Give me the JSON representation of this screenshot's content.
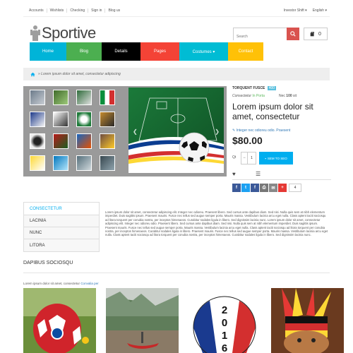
{
  "topbar": {
    "links": [
      "Accounts",
      "Wishlists",
      "Checking",
      "Sign in",
      "Blog us"
    ],
    "language": "Investor Shift ▾",
    "currency": "English ▾"
  },
  "brand": {
    "name": "Sportive"
  },
  "search": {
    "placeholder": "Search"
  },
  "cart": {
    "count": "0"
  },
  "nav": [
    {
      "label": "Home",
      "color": "#00b4d8",
      "width": 52
    },
    {
      "label": "Blog",
      "color": "#4caf50",
      "width": 50
    },
    {
      "label": "Details",
      "color": "#000000",
      "width": 55
    },
    {
      "label": "Pages",
      "color": "#f44336",
      "width": 55
    },
    {
      "label": "Costumes ▾",
      "color": "#00bcd4",
      "width": 69
    },
    {
      "label": "Contact",
      "color": "#ffc107",
      "width": 50
    }
  ],
  "breadcrumb": {
    "text": "» Lorem ipsum dolor sit amet, consectetur adipiscing"
  },
  "product": {
    "brand_label": "TORQUENT FUSCE",
    "brand_count": "400",
    "condition_label": "Consectetur",
    "condition_value": "In Porta",
    "stock_label": "Nec",
    "stock_value": "100",
    "stock_unit": "sit",
    "title": "Lorem ipsum dolor sit amet, consectetur",
    "link": "Integer nec odioreu odio. Praesent",
    "price": "$80.00",
    "qty_label": "Qt",
    "qty_value": "1",
    "add_to_cart": "SEM TO SEO",
    "social_count": "4"
  },
  "tabs": [
    "CONSECTETUR",
    "LACINIA",
    "NUNC",
    "LITORA"
  ],
  "description": "Lorem ipsum dolor sit amet, consectetur adipiscing elit. Integer nec odioreu. Praesent libero. Sed cursus ante dapibus diam. Sed nisi. Nulla quis sem at nibh elementum imperdiet. Duis sagittis ipsum. Praesent mauris. Fusce nec tellus sed augue semper porta. Mauris massa. Vestibulum lacinia arcu eget nulla. Class aptent taciti sociosqu ad litora torquent per conubia nostra, per inceptos himenaeos. Curabitur sodales ligula in libero. Sed dignissim lacinia nunc. Lorem ipsum dolor sit amet, consectetur adipiscing elit. Integer nec odioreu odio. Praesent libero. Sed cursus ante dapibus diam. Sed nisi. Nulla quis sem at nibh elementum imperdiet. Duis sagittis ipsum. Praesent mauris. Fusce nec tellus sed augue semper porta. Mauris massa. Vestibulum lacinia arcu eget nulla. Class aptent taciti sociosqu ad litora torquent per conubia nostra, per inceptos himenaeos. Curabitur sodales ligula in libero. Praesent mauris. Fusce nec tellus sed augue semper porta. Mauris massa. Vestibulum lacinia arcu eget nulla. Class aptent taciti sociosqu ad litora torquent per conubia nostra, per inceptos himenaeos. Curabitur sodales ligula in libero. Sed dignissim lacinia nunc.",
  "related": {
    "title": "DAPIBUS SOCIOSQU",
    "subtitle": "Lorem ipsum dolor sit amet, consectetur",
    "subtitle_link": "Convalia per"
  },
  "colors": {
    "accent": "#00aeef",
    "search_button": "#d9534f"
  }
}
